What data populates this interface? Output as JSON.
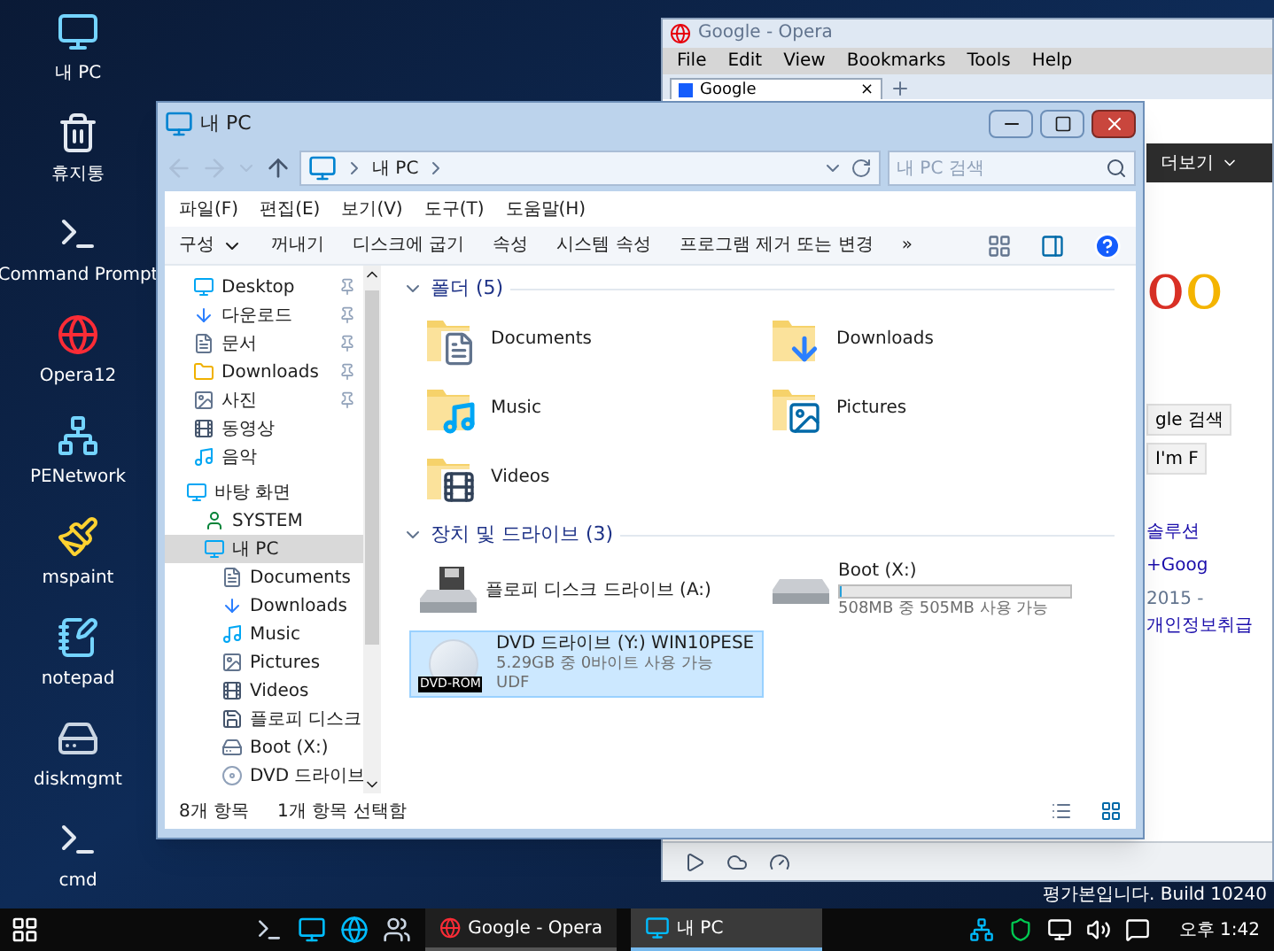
{
  "desktop": {
    "icons": [
      {
        "label": "내 PC",
        "kind": "pc"
      },
      {
        "label": "휴지통",
        "kind": "trash"
      },
      {
        "label": "Command Prompt",
        "kind": "console"
      },
      {
        "label": "Opera12",
        "kind": "opera"
      },
      {
        "label": "PENetwork",
        "kind": "network"
      },
      {
        "label": "mspaint",
        "kind": "paint"
      },
      {
        "label": "notepad",
        "kind": "notepad"
      },
      {
        "label": "diskmgmt",
        "kind": "disk"
      },
      {
        "label": "cmd",
        "kind": "console"
      }
    ],
    "build_notice": "평가본입니다. Build 10240"
  },
  "opera_window": {
    "title": "Google - Opera",
    "menu": [
      "File",
      "Edit",
      "View",
      "Bookmarks",
      "Tools",
      "Help"
    ],
    "tabs": [
      {
        "label": "Google",
        "close": "×",
        "selected": true
      }
    ],
    "page": {
      "more_menu": "더보기",
      "logo_fragment": "oo",
      "buttons": [
        "gle 검색",
        "I'm F"
      ],
      "links": [
        "솔루션",
        "+Goog"
      ],
      "footer_year": "2015 -",
      "footer_link": "개인정보취급"
    }
  },
  "explorer": {
    "title": "내 PC",
    "address": {
      "crumbs": [
        "내 PC"
      ],
      "search_placeholder": "내 PC 검색"
    },
    "menu": [
      "파일(F)",
      "편집(E)",
      "보기(V)",
      "도구(T)",
      "도움말(H)"
    ],
    "commands": [
      {
        "label": "구성",
        "dropdown": true
      },
      {
        "label": "꺼내기",
        "dropdown": false
      },
      {
        "label": "디스크에 굽기",
        "dropdown": false
      },
      {
        "label": "속성",
        "dropdown": false
      },
      {
        "label": "시스템 속성",
        "dropdown": false
      },
      {
        "label": "프로그램 제거 또는 변경",
        "dropdown": false
      }
    ],
    "more_commands": "»",
    "nav": {
      "quick_access": [
        {
          "label": "Desktop",
          "kind": "desktop",
          "pinned": true
        },
        {
          "label": "다운로드",
          "kind": "download",
          "pinned": true
        },
        {
          "label": "문서",
          "kind": "document",
          "pinned": true
        },
        {
          "label": "Downloads",
          "kind": "folder",
          "pinned": true
        },
        {
          "label": "사진",
          "kind": "picture",
          "pinned": true
        },
        {
          "label": "동영상",
          "kind": "video",
          "pinned": false
        },
        {
          "label": "음악",
          "kind": "music",
          "pinned": false
        }
      ],
      "tree": [
        {
          "label": "바탕 화면",
          "kind": "desktop",
          "selected": false,
          "children": [
            {
              "label": "SYSTEM",
              "kind": "user",
              "selected": false
            },
            {
              "label": "내 PC",
              "kind": "pc",
              "selected": true,
              "children": [
                {
                  "label": "Documents",
                  "kind": "document",
                  "selected": false
                },
                {
                  "label": "Downloads",
                  "kind": "download",
                  "selected": false
                },
                {
                  "label": "Music",
                  "kind": "music",
                  "selected": false
                },
                {
                  "label": "Pictures",
                  "kind": "picture",
                  "selected": false
                },
                {
                  "label": "Videos",
                  "kind": "video",
                  "selected": false
                },
                {
                  "label": "플로피 디스크",
                  "kind": "floppy",
                  "selected": false
                },
                {
                  "label": "Boot (X:)",
                  "kind": "hdd",
                  "selected": false
                },
                {
                  "label": "DVD 드라이브",
                  "kind": "dvd",
                  "selected": false
                }
              ]
            }
          ]
        }
      ]
    },
    "groups": [
      {
        "title": "폴더 (5)",
        "kind": "folders",
        "expanded": true,
        "items": [
          {
            "name": "Documents",
            "kind": "document"
          },
          {
            "name": "Downloads",
            "kind": "download"
          },
          {
            "name": "Music",
            "kind": "music"
          },
          {
            "name": "Pictures",
            "kind": "picture"
          },
          {
            "name": "Videos",
            "kind": "video"
          }
        ]
      },
      {
        "title": "장치 및 드라이브 (3)",
        "kind": "drives",
        "expanded": true,
        "items": [
          {
            "name": "플로피 디스크 드라이브 (A:)",
            "kind": "floppy",
            "selected": false
          },
          {
            "name": "Boot (X:)",
            "kind": "hdd",
            "level": 0.01,
            "free_text": "508MB 중 505MB 사용 가능",
            "selected": false
          },
          {
            "name": "DVD 드라이브 (Y:) WIN10PESE",
            "kind": "dvd",
            "free_text": "5.29GB 중 0바이트 사용 가능",
            "filesystem": "UDF",
            "badge": "DVD-ROM",
            "selected": true
          }
        ]
      }
    ],
    "status": {
      "count": "8개 항목",
      "selection": "1개 항목 선택함"
    }
  },
  "taskbar": {
    "apps": [
      {
        "label": "Google - Opera",
        "kind": "opera",
        "selected": false
      },
      {
        "label": "내 PC",
        "kind": "pc",
        "selected": true
      }
    ],
    "clock": "오후 1:42"
  }
}
